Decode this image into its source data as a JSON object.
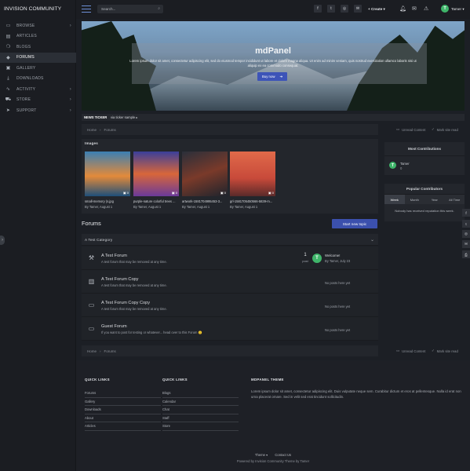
{
  "brand": "INVISION COMMUNITY",
  "sidebar": {
    "items": [
      {
        "label": "BROWSE",
        "icon": "monitor-icon",
        "glyph": "▭",
        "chev": true,
        "active": false
      },
      {
        "label": "ARTICLES",
        "icon": "article-icon",
        "glyph": "▤",
        "chev": false,
        "active": false
      },
      {
        "label": "BLOGS",
        "icon": "blog-icon",
        "glyph": "❍",
        "chev": false,
        "active": false
      },
      {
        "label": "FORUMS",
        "icon": "forums-icon",
        "glyph": "◆",
        "chev": false,
        "active": true
      },
      {
        "label": "GALLERY",
        "icon": "gallery-icon",
        "glyph": "▣",
        "chev": false,
        "active": false
      },
      {
        "label": "DOWNLOADS",
        "icon": "download-icon",
        "glyph": "⤓",
        "chev": false,
        "active": false
      },
      {
        "label": "ACTIVITY",
        "icon": "activity-icon",
        "glyph": "∿",
        "chev": true,
        "active": false
      },
      {
        "label": "STORE",
        "icon": "cart-icon",
        "glyph": "⛟",
        "chev": true,
        "active": false
      },
      {
        "label": "SUPPORT",
        "icon": "support-icon",
        "glyph": "➤",
        "chev": true,
        "active": false
      }
    ]
  },
  "header": {
    "search_placeholder": "Search...",
    "create_label": "Create",
    "user": {
      "initial": "T",
      "name": "Tamer"
    }
  },
  "hero": {
    "title": "mdPanel",
    "text": "Lorem ipsum dolor sit amet, consectetur adipiscing elit, sed do eiusmod tempor incididunt ut labore et dolore magna aliqua. Ut enim ad minim veniam, quis nostrud exercitation ullamco laboris nisi ut aliquip ex ea commodo consequat.",
    "button": "Buy now"
  },
  "ticker": {
    "label": "NEWS TICKER",
    "text": "via ticker sample"
  },
  "breadcrumb": {
    "home": "Home",
    "current": "Forums",
    "unread": "Unread Content",
    "mark_read": "Mark site read"
  },
  "images": {
    "title": "Images",
    "items": [
      {
        "title": "small-memory (s.jpg",
        "by": "By Tamer, August 1",
        "count": "0"
      },
      {
        "title": "purple-nature colorful trees ...",
        "by": "By Tamer, August 1",
        "count": "0"
      },
      {
        "title": "artwork-1581704995453-3...",
        "by": "By Tamer, August 1",
        "count": "0"
      },
      {
        "title": "grl-1581705450566-5839-m...",
        "by": "By Tamer, August 1",
        "count": "0"
      }
    ]
  },
  "forums": {
    "heading": "Forums",
    "start_button": "Start new topic",
    "category": "A Test Category",
    "rows": [
      {
        "name": "A Test Forum",
        "desc": "A test forum that may be removed at any time.",
        "icon": "hammer-icon",
        "glyph": "⚒",
        "count": "1",
        "count_label": "post",
        "last_title": "Welcome!",
        "last_by": "By Tamer, July 23",
        "no_posts": ""
      },
      {
        "name": "A Test Forum Copy",
        "desc": "A test forum that may be removed at any time.",
        "icon": "archive-icon",
        "glyph": "▥",
        "count": "",
        "count_label": "",
        "last_title": "",
        "last_by": "",
        "no_posts": "No posts here yet"
      },
      {
        "name": "A Test Forum Copy Copy",
        "desc": "A test forum that may be removed at any time.",
        "icon": "monitor-icon",
        "glyph": "▭",
        "count": "",
        "count_label": "",
        "last_title": "",
        "last_by": "",
        "no_posts": "No posts here yet"
      },
      {
        "name": "Guest Forum",
        "desc": "If you want to post for testing or whatever... head over to this Forum 🙂",
        "icon": "monitor-icon",
        "glyph": "▭",
        "count": "",
        "count_label": "",
        "last_title": "",
        "last_by": "",
        "no_posts": "No posts here yet"
      }
    ]
  },
  "most_contributions": {
    "title": "Most Contributions",
    "user": "Tamer",
    "value": "0",
    "initial": "T"
  },
  "popular": {
    "title": "Popular Contributors",
    "tabs": [
      "Week",
      "Month",
      "Year",
      "All Time"
    ],
    "active_tab": "Week",
    "empty": "Nobody has received reputation this week."
  },
  "footer": {
    "col1_title": "QUICK LINKS",
    "col1": [
      "Forums",
      "Gallery",
      "Downloads",
      "About",
      "Articles"
    ],
    "col2_title": "QUICK LINKS",
    "col2": [
      "Blogs",
      "Calendar",
      "Chat",
      "Staff",
      "Store"
    ],
    "theme_title": "MDPANEL THEME",
    "theme_text": "Lorem ipsum dolor sit amet, consectetur adipiscing elit. Duis vulputate neque sem. Curabitur dictum et eros at pellentesque. Nulla id erat non urna placerat ornare. Sed in velit sed erat tincidunt sollicitudin.",
    "theme_link": "Theme",
    "contact": "Contact Us",
    "powered": "Powered by Invision Community   Theme by Tamer"
  },
  "colors": {
    "accent": "#3b50ad",
    "avatar": "#3fb56a",
    "bg": "#1c1f25"
  }
}
